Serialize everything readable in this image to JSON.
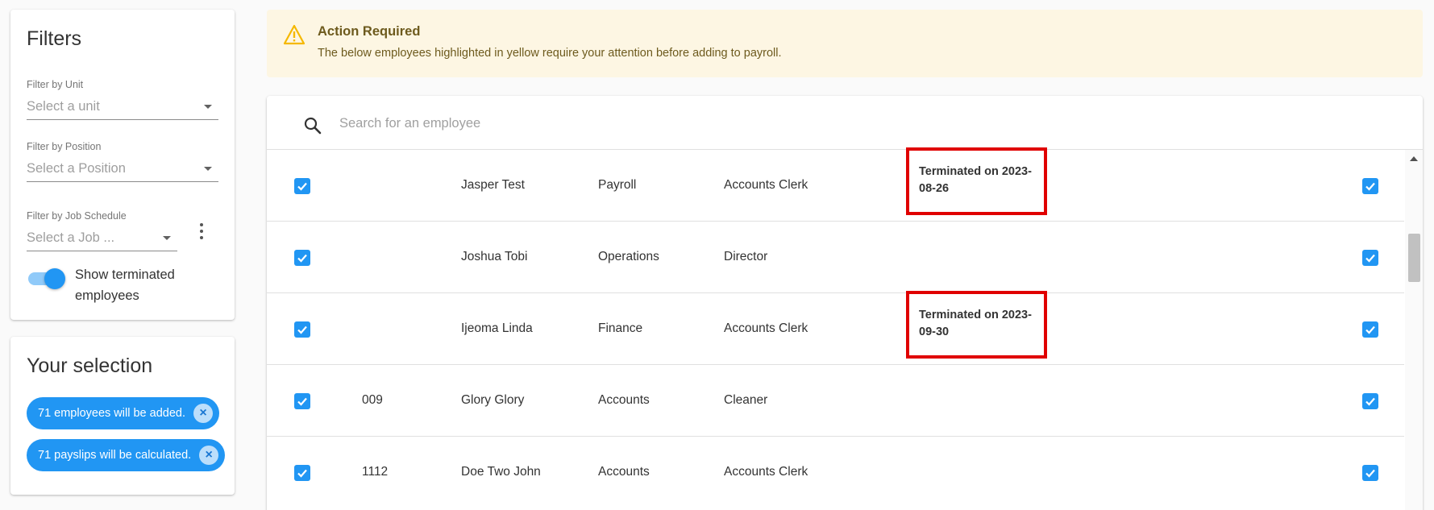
{
  "filters": {
    "title": "Filters",
    "unit": {
      "label": "Filter by Unit",
      "placeholder": "Select a unit"
    },
    "position": {
      "label": "Filter by Position",
      "placeholder": "Select a Position"
    },
    "job_schedule": {
      "label": "Filter by Job Schedule",
      "placeholder": "Select a Job ..."
    },
    "show_terminated": {
      "label": "Show terminated employees",
      "enabled": true
    }
  },
  "selection": {
    "title": "Your selection",
    "chips": [
      {
        "label": "71 employees will be added."
      },
      {
        "label": "71 payslips will be calculated."
      }
    ]
  },
  "alert": {
    "icon": "warning-icon",
    "title": "Action Required",
    "text": "The below employees highlighted in yellow require your attention before adding to payroll."
  },
  "search": {
    "placeholder": "Search for an employee",
    "value": ""
  },
  "employees": [
    {
      "checked": true,
      "code": "",
      "name": "Jasper Test",
      "department": "Payroll",
      "position": "Accounts Clerk",
      "status": "Terminated on 2023-08-26",
      "include": true
    },
    {
      "checked": true,
      "code": "",
      "name": "Joshua Tobi",
      "department": "Operations",
      "position": "Director",
      "status": "",
      "include": true
    },
    {
      "checked": true,
      "code": "",
      "name": "Ijeoma Linda",
      "department": "Finance",
      "position": "Accounts Clerk",
      "status": "Terminated on 2023-09-30",
      "include": true
    },
    {
      "checked": true,
      "code": "009",
      "name": "Glory Glory",
      "department": "Accounts",
      "position": "Cleaner",
      "status": "",
      "include": true
    },
    {
      "checked": true,
      "code": "1112",
      "name": "Doe Two John",
      "department": "Accounts",
      "position": "Accounts Clerk",
      "status": "",
      "include": true
    }
  ],
  "colors": {
    "accent": "#2196f3",
    "alert_background": "#fdf6e3",
    "alert_text": "#6d5a1d",
    "highlight_border": "#e00000"
  }
}
